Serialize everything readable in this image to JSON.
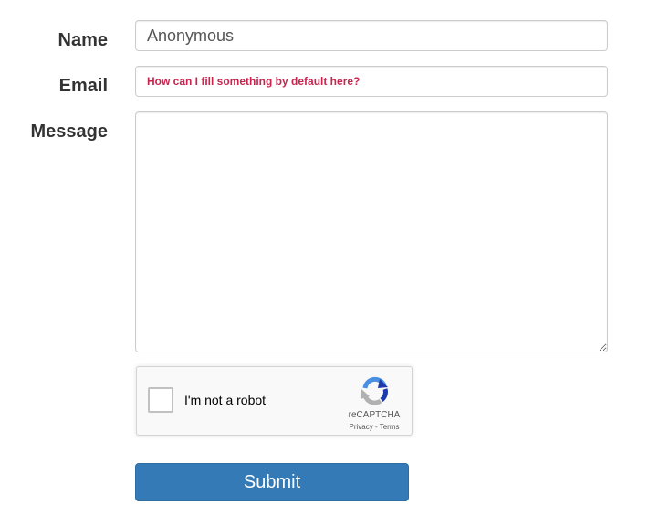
{
  "form": {
    "name": {
      "label": "Name",
      "value": "Anonymous"
    },
    "email": {
      "label": "Email",
      "value": "How can I fill something by default here?"
    },
    "message": {
      "label": "Message",
      "value": ""
    },
    "captcha": {
      "checkbox_label": "I'm not a robot",
      "brand": "reCAPTCHA",
      "privacy_link": "Privacy",
      "separator": " - ",
      "terms_link": "Terms",
      "checked": false
    },
    "submit_label": "Submit"
  },
  "colors": {
    "label_text": "#333333",
    "email_text": "#c7254e",
    "submit_bg": "#337ab7",
    "captcha_bg": "#f9f9f9",
    "logo_blue_dark": "#1c3aa9",
    "logo_blue": "#4a90e2",
    "logo_gray": "#b1b1b1"
  },
  "icons": {
    "captcha_logo": "recaptcha-logo-icon"
  }
}
